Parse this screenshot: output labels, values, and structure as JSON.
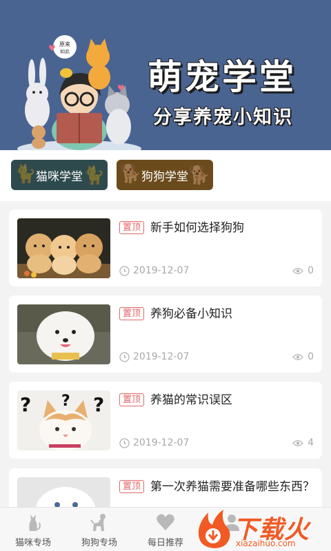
{
  "banner": {
    "title": "萌宠学堂",
    "subtitle": "分享养宠小知识",
    "bubble_text": "原来 如此"
  },
  "categories": [
    {
      "label": "猫咪学堂",
      "color": "#2e4a4c"
    },
    {
      "label": "狗狗学堂",
      "color": "#6b4a1c"
    }
  ],
  "articles": [
    {
      "badge": "置顶",
      "title": "新手如何选择狗狗",
      "date": "2019-12-07",
      "views": "0",
      "thumb": "golden-puppies"
    },
    {
      "badge": "置顶",
      "title": "养狗必备小知识",
      "date": "2019-12-07",
      "views": "0",
      "thumb": "white-pomeranian"
    },
    {
      "badge": "置顶",
      "title": "养猫的常识误区",
      "date": "2019-12-07",
      "views": "4",
      "thumb": "question-cat"
    },
    {
      "badge": "置顶",
      "title": "第一次养猫需要准备哪些东西？",
      "date": "",
      "views": "",
      "thumb": "white-kitten"
    }
  ],
  "bottom_nav": [
    {
      "label": "猫咪专场",
      "icon": "cat-icon"
    },
    {
      "label": "狗狗专场",
      "icon": "dog-icon"
    },
    {
      "label": "每日推荐",
      "icon": "heart-icon"
    },
    {
      "label": "",
      "icon": "user-icon"
    }
  ],
  "watermark": {
    "text": "下载火",
    "url": "xiazaihuo.com"
  },
  "colors": {
    "banner_bg": "#4a6491",
    "badge_red": "#e06666",
    "watermark_orange": "#f15a24"
  }
}
